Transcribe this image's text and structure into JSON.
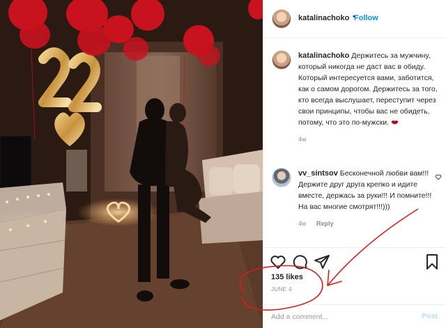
{
  "post": {
    "author": "katalinachoko",
    "follow_label": "Follow",
    "dot": "•"
  },
  "caption": {
    "username": "katalinachoko",
    "text": "Держитесь за мужчину, который никогда не даст вас в обиду. Который интересуется вами, заботится, как о самом дорогом. Держитесь за того, кто всегда выслушает, переступит через свои принципы, чтобы вас не обидеть, потому, что это по-мужски.",
    "emoji": "lips-icon",
    "time": "4w"
  },
  "comments": [
    {
      "username": "vv_sintsov",
      "text": "Бесконечной любви вам!!! Держите друг друга крепко и идите вместе, держась за руки!!! И помните!!! На вас многие смотрят!!!)))",
      "time": "4w",
      "reply_label": "Reply"
    }
  ],
  "actions": {
    "like": "heart-outline-icon",
    "comment": "comment-bubble-icon",
    "share": "paper-plane-icon",
    "save": "bookmark-icon"
  },
  "likes": "135 likes",
  "date": "JUNE 4",
  "add_comment": {
    "placeholder": "Add a comment...",
    "post_label": "Post"
  },
  "photo": {
    "balloon_number": "22"
  },
  "colors": {
    "link": "#0095f6",
    "annotation": "#e0181b",
    "balloon_red": "#c8121e",
    "balloon_gold": "#d9a64a"
  }
}
